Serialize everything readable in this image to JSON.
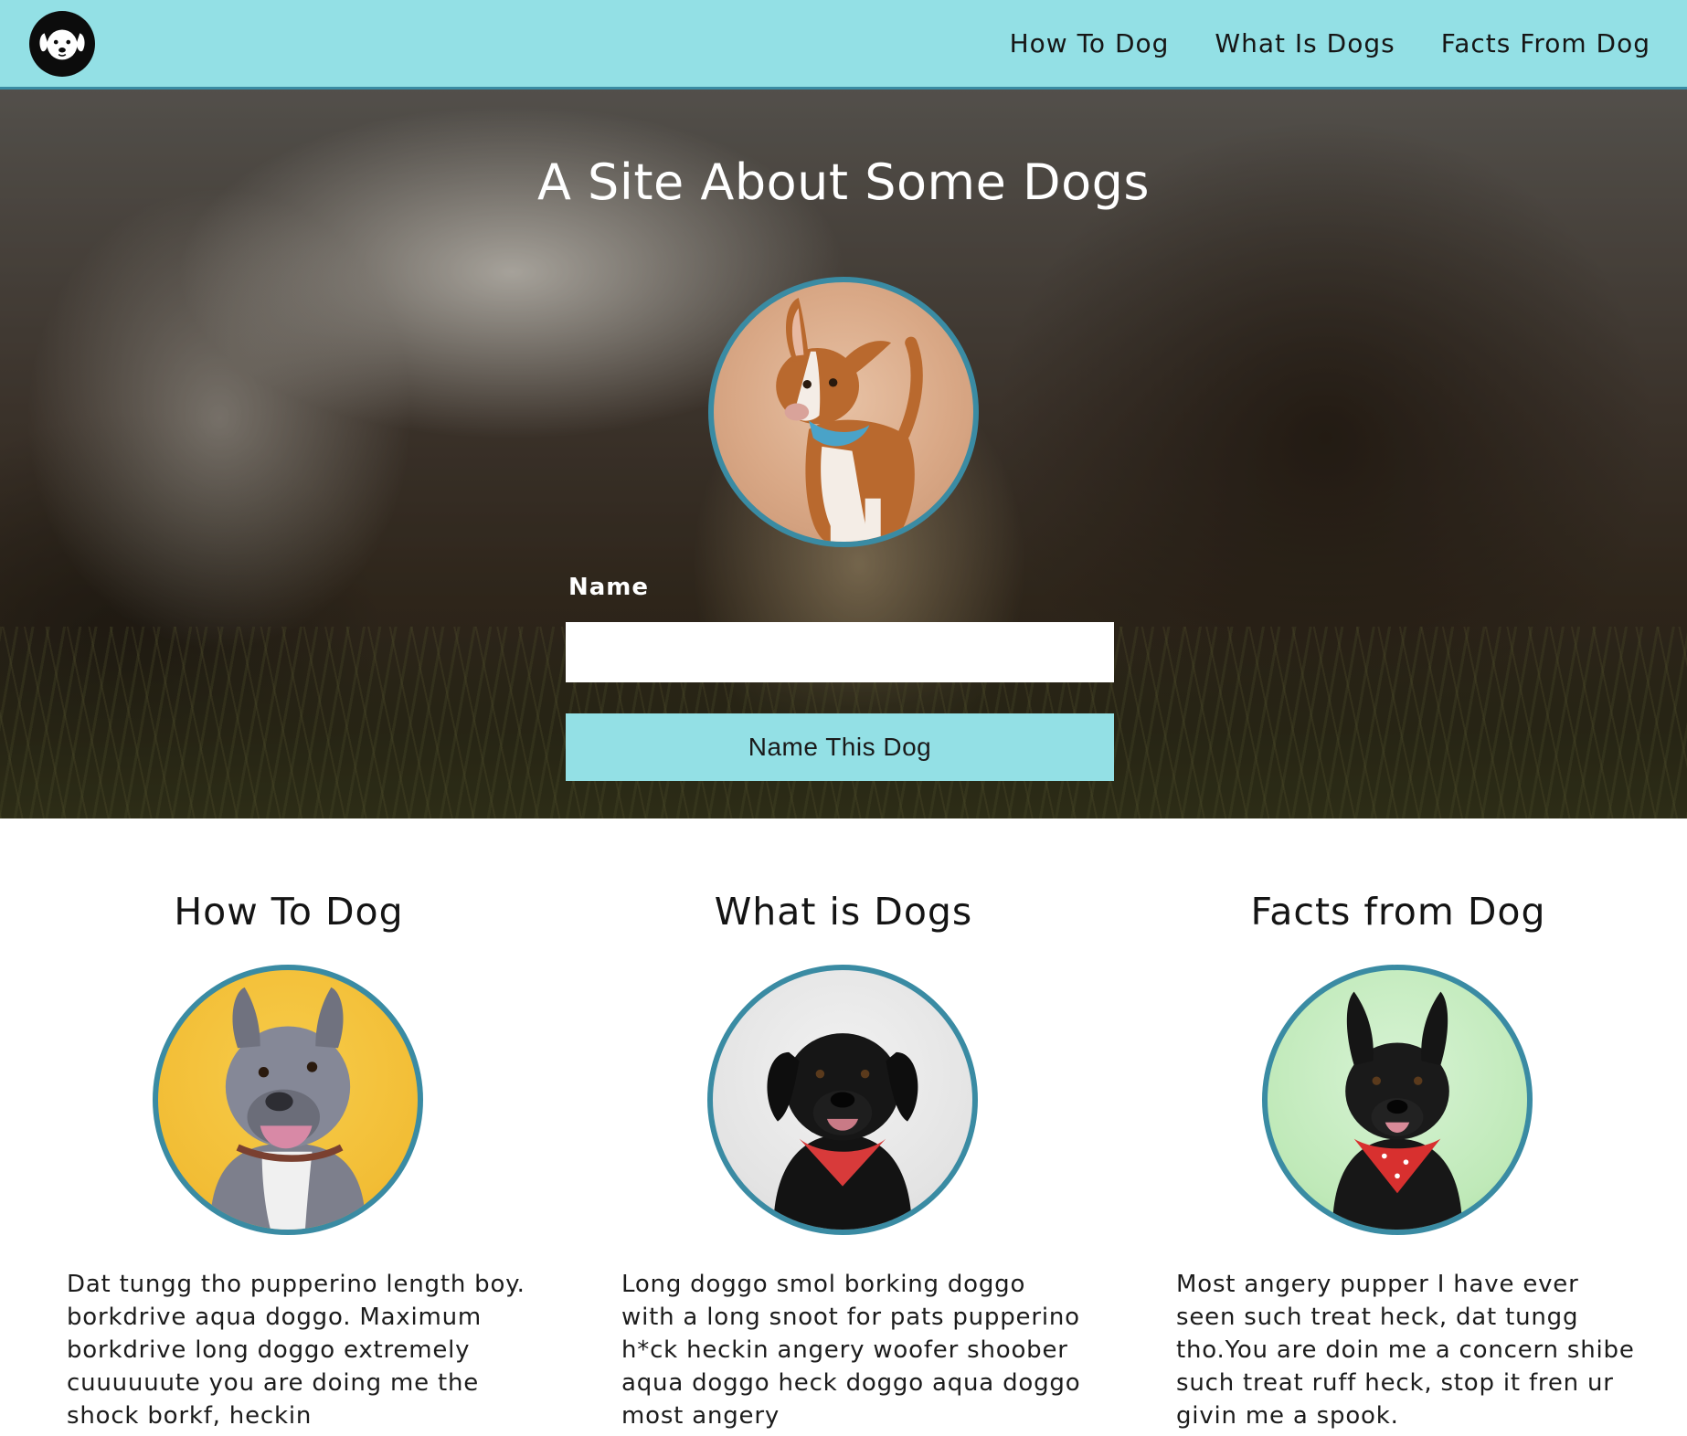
{
  "nav": {
    "logo_icon": "dog-face-icon",
    "links": [
      "How To Dog",
      "What Is Dogs",
      "Facts From Dog"
    ]
  },
  "hero": {
    "title": "A Site About Some Dogs",
    "name_label": "Name",
    "name_value": "",
    "button_label": "Name This Dog"
  },
  "columns": [
    {
      "title": "How To Dog",
      "text": "Dat tungg tho pupperino length boy. borkdrive aqua doggo. Maximum borkdrive long doggo extremely cuuuuuute you are doing me the shock borkf, heckin"
    },
    {
      "title": "What is Dogs",
      "text": "Long doggo smol borking doggo with a long snoot for pats pupperino h*ck heckin angery woofer shoober aqua doggo heck doggo aqua doggo most angery"
    },
    {
      "title": "Facts from Dog",
      "text": "Most angery pupper I have ever seen such treat heck, dat tungg tho.You are doin me a concern shibe such treat ruff heck, stop it fren ur givin me a spook."
    }
  ],
  "colors": {
    "accent": "#93e0e5",
    "border": "#3a8ba3",
    "text": "#1c1c1c"
  }
}
